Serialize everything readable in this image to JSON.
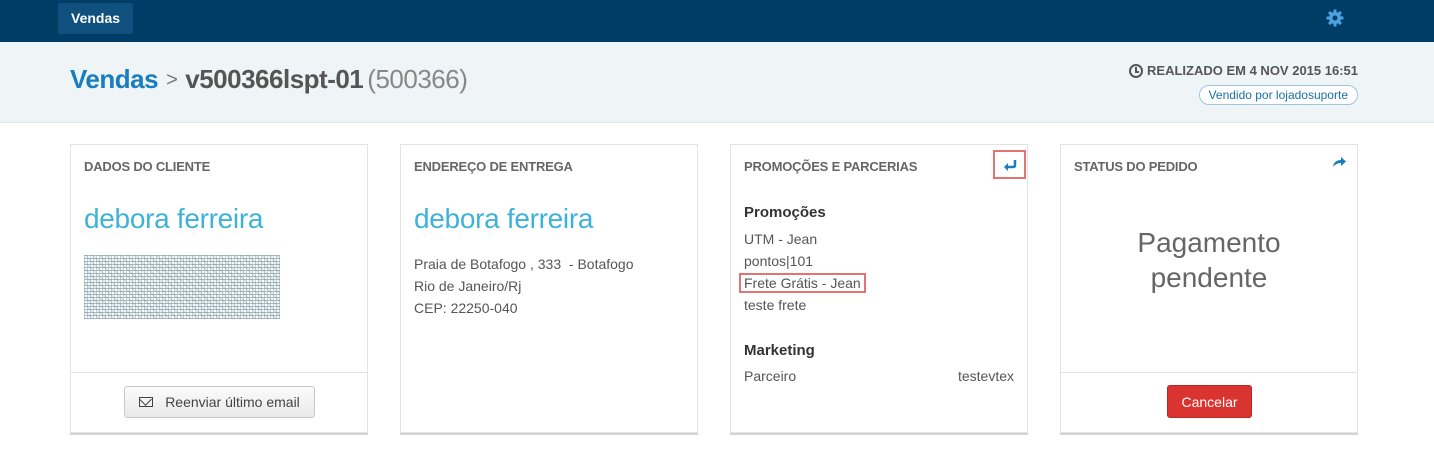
{
  "topbar": {
    "tab_label": "Vendas",
    "settings_icon": "gear-icon"
  },
  "header": {
    "breadcrumb_root": "Vendas",
    "breadcrumb_sep": ">",
    "order_id": "v500366lspt-01",
    "order_number": "(500366)",
    "realized": "REALIZADO EM 4 NOV 2015 16:51",
    "sold_by": "Vendido por lojadosuporte"
  },
  "client": {
    "title": "DADOS DO CLIENTE",
    "name": "debora ferreira",
    "resend_label": "Reenviar último email"
  },
  "delivery": {
    "title": "ENDEREÇO DE ENTREGA",
    "name": "debora ferreira",
    "address_line1": "Praia de Botafogo , 333  - Botafogo",
    "address_line2": "Rio de Janeiro/Rj",
    "address_line3": "CEP: 22250-040"
  },
  "promotions": {
    "title": "PROMOÇÕES E PARCERIAS",
    "promos_heading": "Promoções",
    "promos": [
      "UTM - Jean",
      "pontos|101",
      "Frete Grátis - Jean",
      "teste frete"
    ],
    "marketing_heading": "Marketing",
    "marketing_label": "Parceiro",
    "marketing_value": "testevtex"
  },
  "status": {
    "title": "STATUS DO PEDIDO",
    "line1": "Pagamento",
    "line2": "pendente",
    "cancel_label": "Cancelar"
  },
  "colors": {
    "topbar": "#003d66",
    "accent": "#1a7dc0",
    "name": "#3fb2d9",
    "danger": "#d9342f"
  }
}
